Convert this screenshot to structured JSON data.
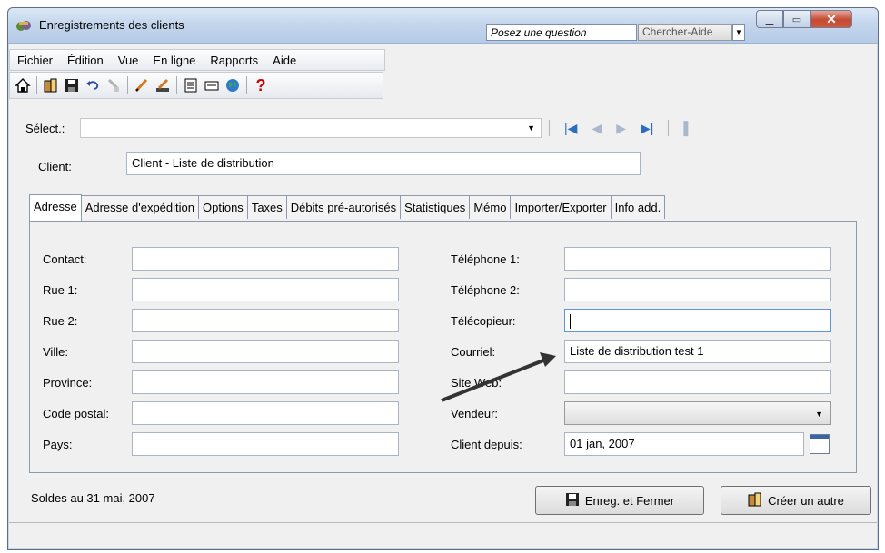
{
  "window": {
    "title": "Enregistrements des clients",
    "ask_placeholder": "Posez une question",
    "help_button": "Chercher-Aide"
  },
  "menu": [
    "Fichier",
    "Édition",
    "Vue",
    "En ligne",
    "Rapports",
    "Aide"
  ],
  "toolbar_icons": [
    "home-icon",
    "open-icon",
    "save-icon",
    "undo-icon",
    "eraser-icon",
    "pen-icon",
    "edit-icon",
    "report-icon",
    "card-icon",
    "globe-icon",
    "help-icon"
  ],
  "select": {
    "label": "Sélect.:",
    "value": ""
  },
  "client": {
    "label": "Client:",
    "value": "Client - Liste de distribution"
  },
  "tabs": [
    "Adresse",
    "Adresse d'expédition",
    "Options",
    "Taxes",
    "Débits pré-autorisés",
    "Statistiques",
    "Mémo",
    "Importer/Exporter",
    "Info add."
  ],
  "left_fields": [
    {
      "label": "Contact:",
      "value": ""
    },
    {
      "label": "Rue 1:",
      "value": ""
    },
    {
      "label": "Rue 2:",
      "value": ""
    },
    {
      "label": "Ville:",
      "value": ""
    },
    {
      "label": "Province:",
      "value": ""
    },
    {
      "label": "Code postal:",
      "value": ""
    },
    {
      "label": "Pays:",
      "value": ""
    }
  ],
  "right_fields": [
    {
      "label": "Téléphone 1:",
      "value": ""
    },
    {
      "label": "Téléphone 2:",
      "value": ""
    },
    {
      "label": "Télécopieur:",
      "value": ""
    },
    {
      "label": "Courriel:",
      "value": "Liste de distribution test 1"
    },
    {
      "label": "Site Web:",
      "value": ""
    },
    {
      "label": "Vendeur:",
      "value": ""
    },
    {
      "label": "Client depuis:",
      "value": "01 jan, 2007"
    }
  ],
  "balances_text": "Soldes au 31 mai, 2007",
  "buttons": {
    "save_close": "Enreg. et Fermer",
    "create_other": "Créer un autre"
  },
  "colors": {
    "nav_blue": "#2b6cc4",
    "annotation_arrow": "#333333",
    "help_red": "#d00000"
  }
}
